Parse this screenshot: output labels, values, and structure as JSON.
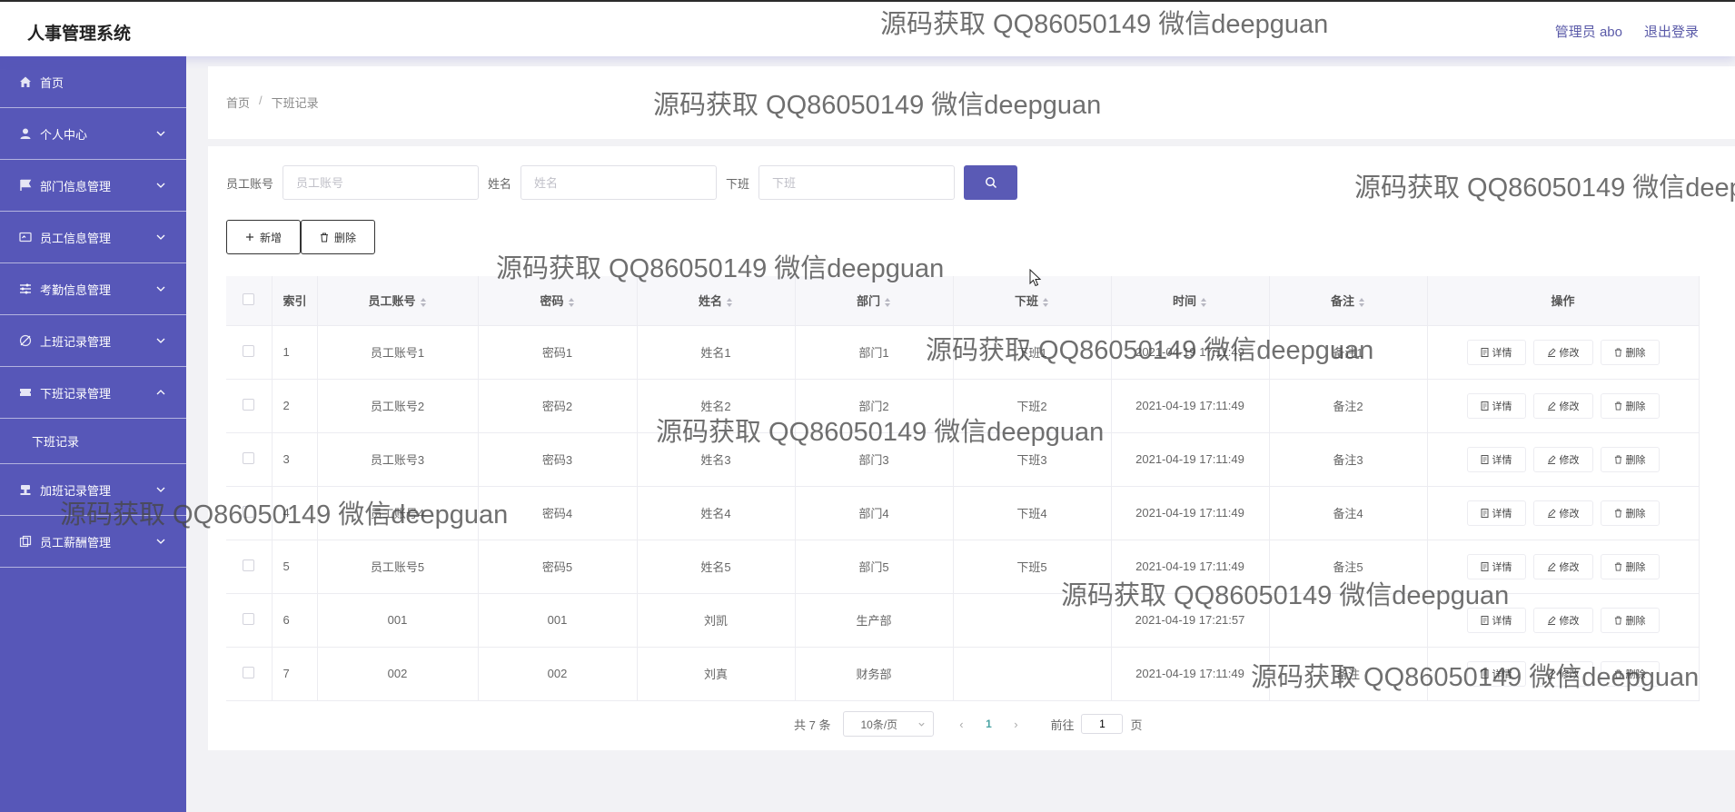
{
  "app": {
    "title": "人事管理系统"
  },
  "header": {
    "user": "管理员 abo",
    "logout": "退出登录"
  },
  "sidebar": {
    "items": [
      {
        "label": "首页",
        "icon": "home-icon"
      },
      {
        "label": "个人中心",
        "icon": "user-icon"
      },
      {
        "label": "部门信息管理",
        "icon": "flag-icon"
      },
      {
        "label": "员工信息管理",
        "icon": "id-card-icon"
      },
      {
        "label": "考勤信息管理",
        "icon": "sliders-icon"
      },
      {
        "label": "上班记录管理",
        "icon": "clock-off-icon"
      },
      {
        "label": "下班记录管理",
        "icon": "ticket-icon"
      },
      {
        "label": "加班记录管理",
        "icon": "stamp-icon"
      },
      {
        "label": "员工薪酬管理",
        "icon": "copy-icon"
      }
    ],
    "submenu": {
      "label": "下班记录"
    }
  },
  "breadcrumb": {
    "home": "首页",
    "sep": "/",
    "current": "下班记录"
  },
  "search": {
    "account_label": "员工账号",
    "account_placeholder": "员工账号",
    "name_label": "姓名",
    "name_placeholder": "姓名",
    "offwork_label": "下班",
    "offwork_placeholder": "下班"
  },
  "toolbar": {
    "add": "新增",
    "delete": "删除"
  },
  "table": {
    "headers": {
      "index": "索引",
      "account": "员工账号",
      "password": "密码",
      "name": "姓名",
      "dept": "部门",
      "offwork": "下班",
      "time": "时间",
      "remark": "备注",
      "ops": "操作"
    },
    "ops": {
      "detail": "详情",
      "edit": "修改",
      "delete": "删除"
    },
    "rows": [
      {
        "index": "1",
        "account": "员工账号1",
        "password": "密码1",
        "name": "姓名1",
        "dept": "部门1",
        "offwork": "下班1",
        "time": "2021-04-19 17:11:49",
        "remark": "备注1"
      },
      {
        "index": "2",
        "account": "员工账号2",
        "password": "密码2",
        "name": "姓名2",
        "dept": "部门2",
        "offwork": "下班2",
        "time": "2021-04-19 17:11:49",
        "remark": "备注2"
      },
      {
        "index": "3",
        "account": "员工账号3",
        "password": "密码3",
        "name": "姓名3",
        "dept": "部门3",
        "offwork": "下班3",
        "time": "2021-04-19 17:11:49",
        "remark": "备注3"
      },
      {
        "index": "4",
        "account": "员工账号4",
        "password": "密码4",
        "name": "姓名4",
        "dept": "部门4",
        "offwork": "下班4",
        "time": "2021-04-19 17:11:49",
        "remark": "备注4"
      },
      {
        "index": "5",
        "account": "员工账号5",
        "password": "密码5",
        "name": "姓名5",
        "dept": "部门5",
        "offwork": "下班5",
        "time": "2021-04-19 17:11:49",
        "remark": "备注5"
      },
      {
        "index": "6",
        "account": "001",
        "password": "001",
        "name": "刘凯",
        "dept": "生产部",
        "offwork": "",
        "time": "2021-04-19 17:21:57",
        "remark": ""
      },
      {
        "index": "7",
        "account": "002",
        "password": "002",
        "name": "刘真",
        "dept": "财务部",
        "offwork": "",
        "time": "2021-04-19 17:11:49",
        "remark": "备注"
      }
    ]
  },
  "pagination": {
    "total": "共 7 条",
    "page_size": "10条/页",
    "current": "1",
    "goto_label": "前往",
    "goto_value": "1",
    "goto_suffix": "页"
  },
  "watermark": "源码获取 QQ86050149 微信deepguan",
  "colors": {
    "sidebar": "#5757b8",
    "accent": "#5a5ab5"
  }
}
